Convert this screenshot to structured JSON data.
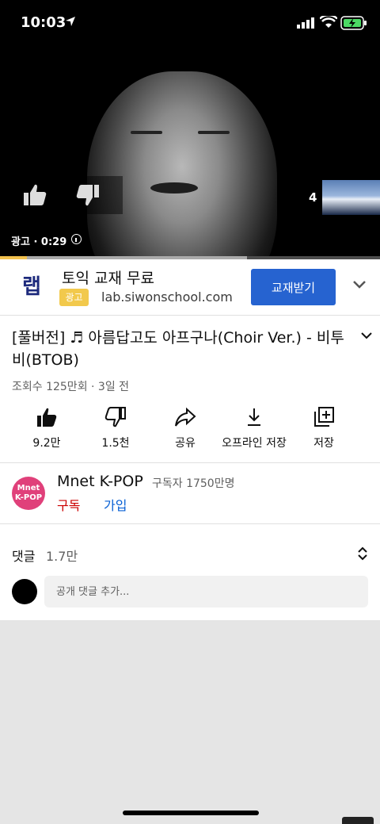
{
  "status_bar": {
    "time": "10:03"
  },
  "player": {
    "ad_count": "4",
    "ad_label": "광고 · 0:29",
    "progress_played_fraction": 0.07,
    "progress_buffered_fraction": 0.65
  },
  "ad": {
    "logo_text": "랩",
    "title": "토익 교재 무료",
    "badge": "광고",
    "url": "lab.siwonschool.com",
    "cta": "교재받기"
  },
  "video": {
    "title": "[풀버전] ♬ 아름답고도 아프구나(Choir Ver.) - 비투비(BTOB)",
    "meta": "조회수 125만회 · 3일 전"
  },
  "actions": [
    {
      "label": "9.2만",
      "icon": "thumbs-up-icon"
    },
    {
      "label": "1.5천",
      "icon": "thumbs-down-icon"
    },
    {
      "label": "공유",
      "icon": "share-icon"
    },
    {
      "label": "오프라인 저장",
      "icon": "download-icon"
    },
    {
      "label": "저장",
      "icon": "add-to-playlist-icon"
    }
  ],
  "channel": {
    "avatar_text": "Mnet K-POP",
    "name": "Mnet K-POP",
    "subscribers": "구독자 1750만명",
    "subscribe": "구독",
    "join": "가입"
  },
  "comments": {
    "label": "댓글",
    "count": "1.7만",
    "placeholder": "공개 댓글 추가..."
  },
  "colors": {
    "cta_blue": "#2663d0",
    "subscribe_red": "#cc0000",
    "join_blue": "#065fd4",
    "ad_badge_yellow": "#f2c94c",
    "channel_pink": "#e0407a"
  }
}
